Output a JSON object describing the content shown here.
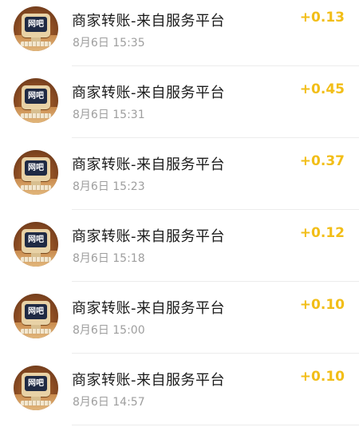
{
  "transactions": [
    {
      "avatar_text": "网吧",
      "title": "商家转账-来自服务平台",
      "time": "8月6日 15:35",
      "amount": "+0.13"
    },
    {
      "avatar_text": "网吧",
      "title": "商家转账-来自服务平台",
      "time": "8月6日 15:31",
      "amount": "+0.45"
    },
    {
      "avatar_text": "网吧",
      "title": "商家转账-来自服务平台",
      "time": "8月6日 15:23",
      "amount": "+0.37"
    },
    {
      "avatar_text": "网吧",
      "title": "商家转账-来自服务平台",
      "time": "8月6日 15:18",
      "amount": "+0.12"
    },
    {
      "avatar_text": "网吧",
      "title": "商家转账-来自服务平台",
      "time": "8月6日 15:00",
      "amount": "+0.10"
    },
    {
      "avatar_text": "网吧",
      "title": "商家转账-来自服务平台",
      "time": "8月6日 14:57",
      "amount": "+0.10"
    }
  ],
  "colors": {
    "amount": "#f2be18",
    "title": "#1a1a1a",
    "time": "#9e9e9e",
    "divider": "#ececec"
  },
  "icons": {
    "avatar": "internet-cafe-monitor-icon"
  }
}
